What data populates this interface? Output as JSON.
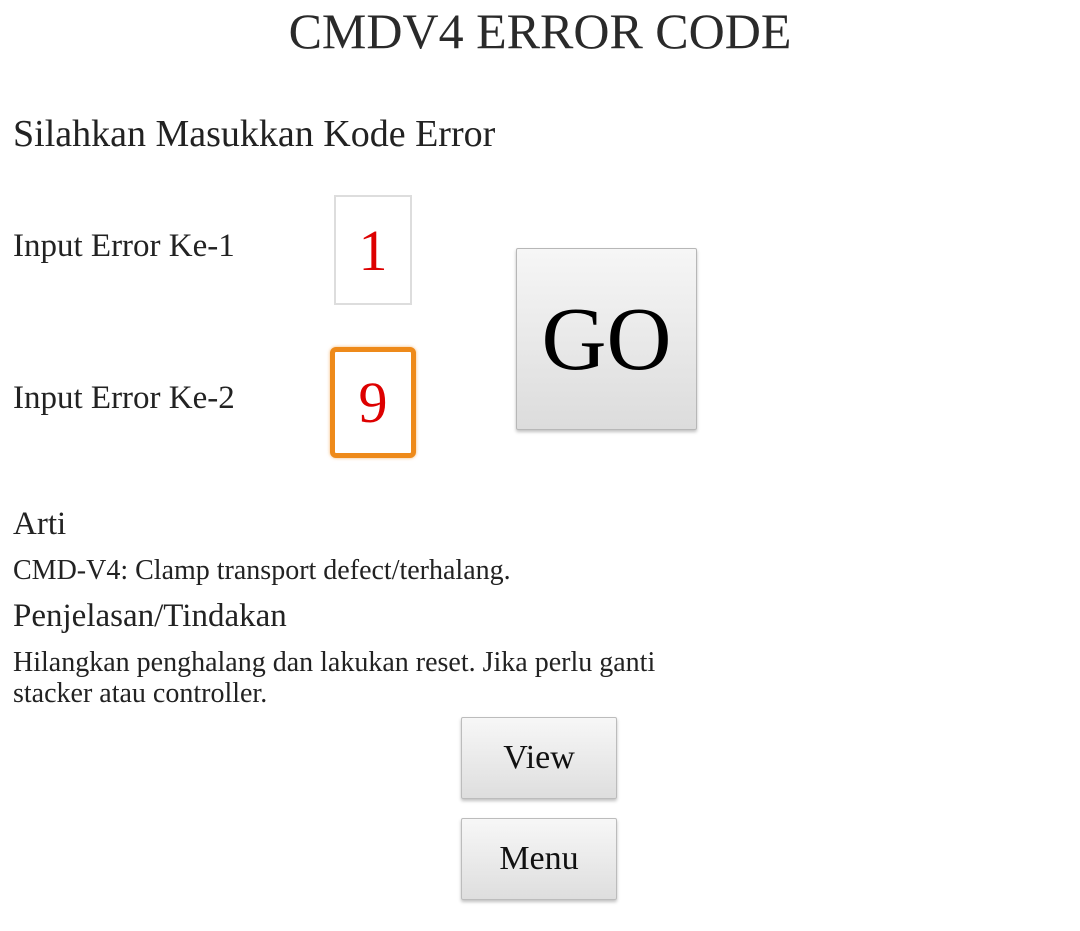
{
  "header": {
    "title": "CMDV4 ERROR CODE"
  },
  "form": {
    "prompt": "Silahkan Masukkan Kode Error",
    "input1": {
      "label": "Input Error Ke-1",
      "value": "1"
    },
    "input2": {
      "label": "Input Error Ke-2",
      "value": "9"
    },
    "go_label": "GO"
  },
  "result": {
    "arti_heading": "Arti",
    "arti_text": "CMD-V4: Clamp transport defect/terhalang.",
    "penjelasan_heading": "Penjelasan/Tindakan",
    "penjelasan_text": "Hilangkan penghalang dan lakukan  reset. Jika perlu ganti stacker atau controller."
  },
  "actions": {
    "view_label": "View",
    "menu_label": "Menu"
  },
  "colors": {
    "input_text": "#dd0000",
    "focus_border": "#ee8a1a"
  }
}
